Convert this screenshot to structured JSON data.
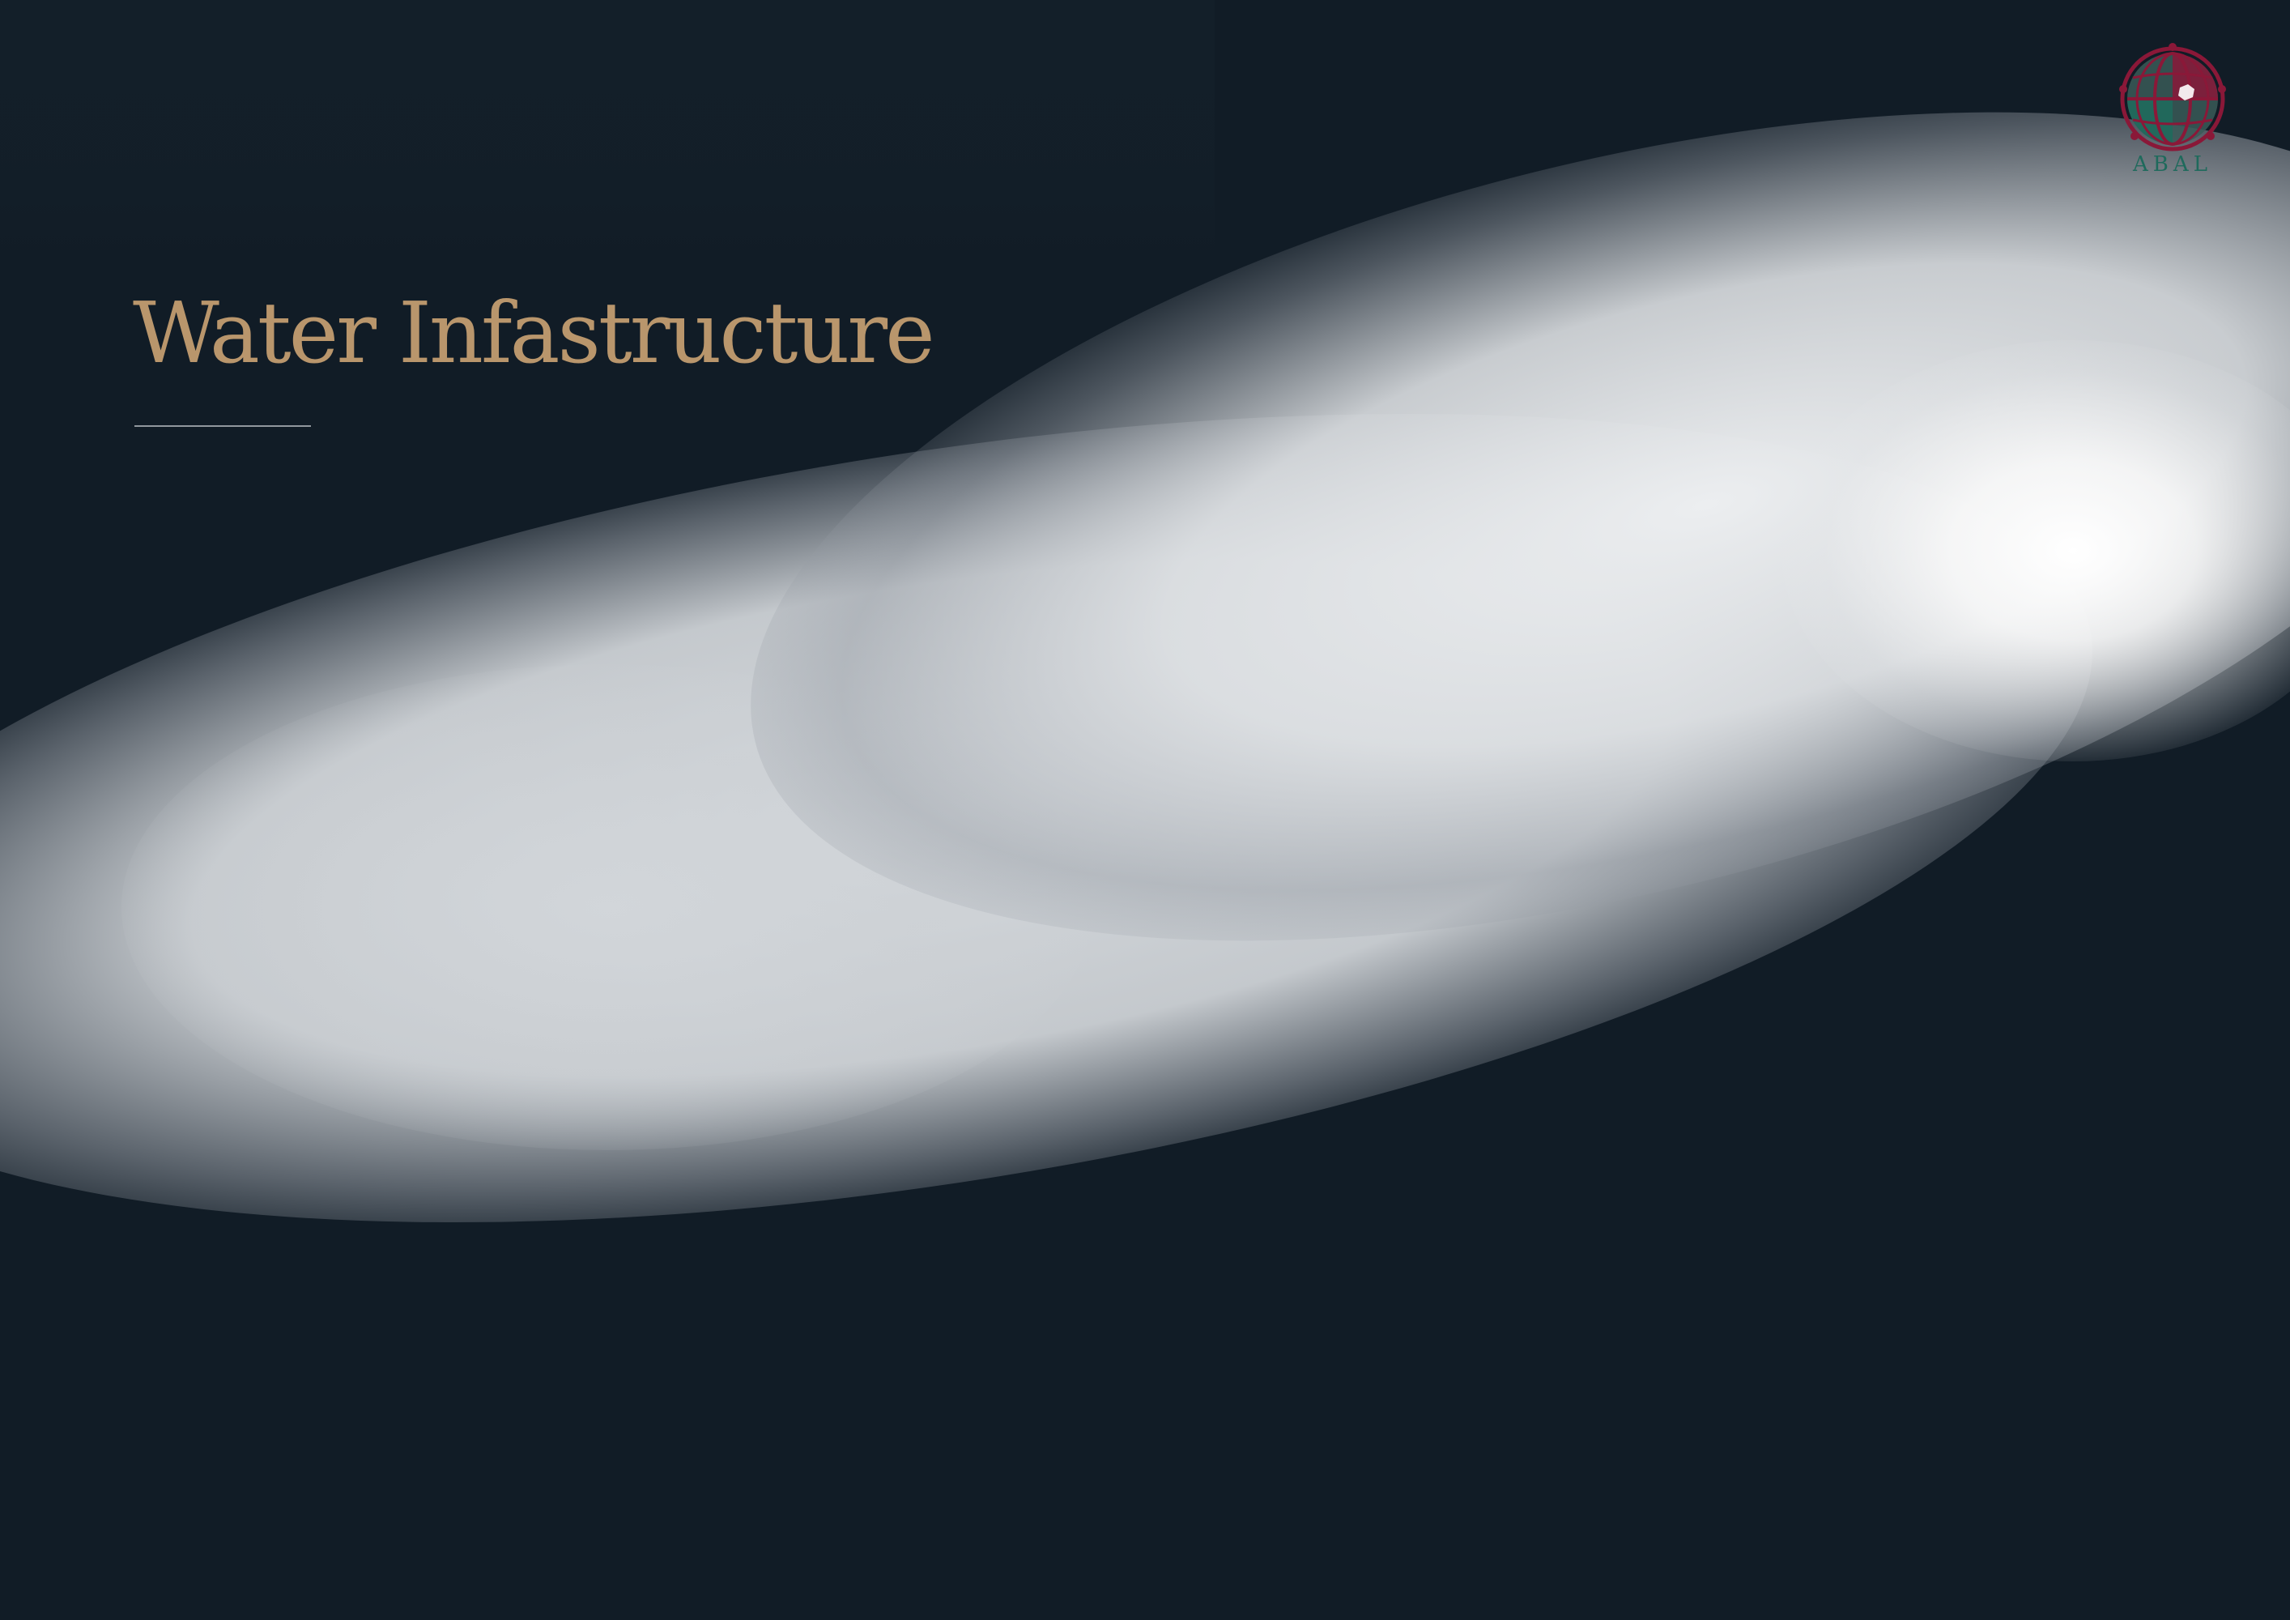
{
  "page": {
    "title": "Water Infastructure"
  },
  "logo": {
    "name": "ABAL",
    "tagline": "",
    "icon": "globe-emblem-icon",
    "colors": {
      "primary": "#8a1838",
      "secondary": "#1f6a5c"
    }
  },
  "colors": {
    "background": "#111c26",
    "title": "#b9966c",
    "highlight": "#ffffff"
  }
}
